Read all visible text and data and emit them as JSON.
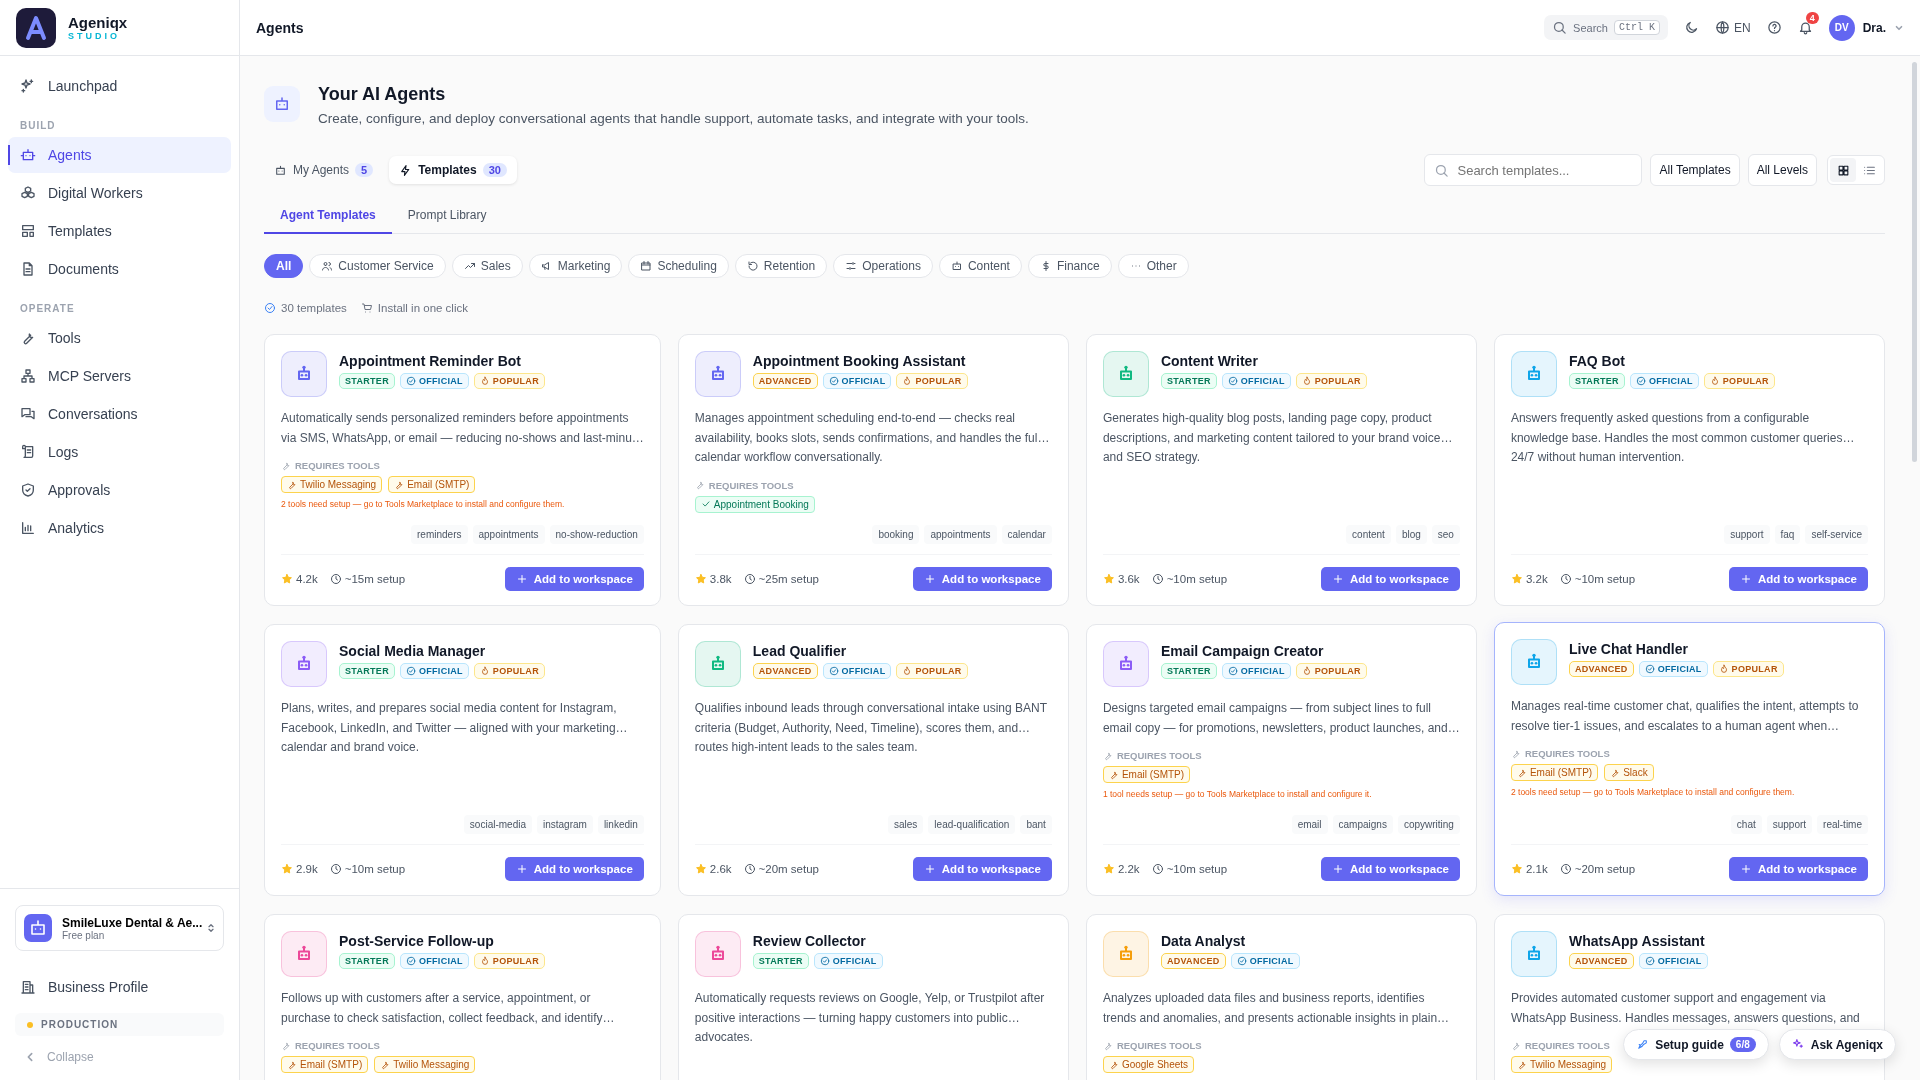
{
  "brand": {
    "name": "Ageniqx",
    "sub": "STUDIO"
  },
  "sidebar": {
    "nav": [
      {
        "kind": "link",
        "label": "Launchpad",
        "selected": false
      },
      {
        "kind": "section",
        "label": "BUILD"
      },
      {
        "kind": "link",
        "label": "Agents",
        "selected": true
      },
      {
        "kind": "link",
        "label": "Digital Workers",
        "selected": false
      },
      {
        "kind": "link",
        "label": "Templates",
        "selected": false
      },
      {
        "kind": "link",
        "label": "Documents",
        "selected": false
      },
      {
        "kind": "section",
        "label": "OPERATE"
      },
      {
        "kind": "link",
        "label": "Tools",
        "selected": false
      },
      {
        "kind": "link",
        "label": "MCP Servers",
        "selected": false
      },
      {
        "kind": "link",
        "label": "Conversations",
        "selected": false
      },
      {
        "kind": "link",
        "label": "Logs",
        "selected": false
      },
      {
        "kind": "link",
        "label": "Approvals",
        "selected": false
      },
      {
        "kind": "link",
        "label": "Analytics",
        "selected": false
      }
    ],
    "workspace": {
      "name": "SmileLuxe Dental & Ae...",
      "plan": "Free plan"
    },
    "business_profile": "Business Profile",
    "environment": "PRODUCTION",
    "collapse": "Collapse"
  },
  "header": {
    "title": "Agents",
    "search": "Search",
    "shortcut": "Ctrl K",
    "language": "EN",
    "notifications": "4",
    "avatar": "DV",
    "user": "Dra."
  },
  "page": {
    "title": "Your AI Agents",
    "subtitle": "Create, configure, and deploy conversational agents that handle support, automate tasks, and integrate with your tools."
  },
  "tabs": [
    {
      "label": "My Agents",
      "count": "5",
      "selected": false
    },
    {
      "label": "Templates",
      "count": "30",
      "selected": true
    }
  ],
  "search": {
    "placeholder": "Search templates..."
  },
  "filters": [
    "All Templates",
    "All Levels"
  ],
  "views": [
    {
      "kind": "grid",
      "selected": true
    },
    {
      "kind": "list",
      "selected": false
    }
  ],
  "subtabs": [
    {
      "label": "Agent Templates",
      "selected": true
    },
    {
      "label": "Prompt Library",
      "selected": false
    }
  ],
  "categories": [
    {
      "label": "All",
      "selected": true
    },
    {
      "label": "Customer Service",
      "selected": false
    },
    {
      "label": "Sales",
      "selected": false
    },
    {
      "label": "Marketing",
      "selected": false
    },
    {
      "label": "Scheduling",
      "selected": false
    },
    {
      "label": "Retention",
      "selected": false
    },
    {
      "label": "Operations",
      "selected": false
    },
    {
      "label": "Content",
      "selected": false
    },
    {
      "label": "Finance",
      "selected": false
    },
    {
      "label": "Other",
      "selected": false
    }
  ],
  "meta": {
    "count": "30 templates",
    "install": "Install in one click"
  },
  "cards": [
    {
      "name": "Appointment Reminder Bot",
      "color": "#6366f1",
      "selected": false,
      "badges": [
        {
          "kind": "starter",
          "label": "STARTER"
        },
        {
          "kind": "official",
          "label": "OFFICIAL"
        },
        {
          "kind": "popular",
          "label": "POPULAR"
        }
      ],
      "description": [
        "Automatically sends personalized reminders before appointments",
        "via SMS, WhatsApp, or email — reducing no-shows and last-minu…"
      ],
      "tools_label": "REQUIRES TOOLS",
      "tools": [
        {
          "name": "Twilio Messaging",
          "installed": false
        },
        {
          "name": "Email (SMTP)",
          "installed": false
        }
      ],
      "tools_note": "2 tools need setup — go to Tools Marketplace to install and configure them.",
      "tags": [
        "reminders",
        "appointments",
        "no-show-reduction"
      ],
      "rating": "4.2k",
      "setup": "~15m setup",
      "action": "Add to workspace"
    },
    {
      "name": "Appointment Booking Assistant",
      "color": "#6366f1",
      "selected": false,
      "badges": [
        {
          "kind": "advanced",
          "label": "ADVANCED"
        },
        {
          "kind": "official",
          "label": "OFFICIAL"
        },
        {
          "kind": "popular",
          "label": "POPULAR"
        }
      ],
      "description": [
        "Manages appointment scheduling end-to-end — checks real",
        "availability, books slots, sends confirmations, and handles the ful…",
        "calendar workflow conversationally."
      ],
      "tools_label": "REQUIRES TOOLS",
      "tools": [
        {
          "name": "Appointment Booking",
          "installed": true
        }
      ],
      "tags": [
        "booking",
        "appointments",
        "calendar"
      ],
      "rating": "3.8k",
      "setup": "~25m setup",
      "action": "Add to workspace"
    },
    {
      "name": "Content Writer",
      "color": "#10b981",
      "selected": false,
      "badges": [
        {
          "kind": "starter",
          "label": "STARTER"
        },
        {
          "kind": "official",
          "label": "OFFICIAL"
        },
        {
          "kind": "popular",
          "label": "POPULAR"
        }
      ],
      "description": [
        "Generates high-quality blog posts, landing page copy, product",
        "descriptions, and marketing content tailored to your brand voice…",
        "and SEO strategy."
      ],
      "tags": [
        "content",
        "blog",
        "seo"
      ],
      "rating": "3.6k",
      "setup": "~10m setup",
      "action": "Add to workspace"
    },
    {
      "name": "FAQ Bot",
      "color": "#0ea5e9",
      "selected": false,
      "badges": [
        {
          "kind": "starter",
          "label": "STARTER"
        },
        {
          "kind": "official",
          "label": "OFFICIAL"
        },
        {
          "kind": "popular",
          "label": "POPULAR"
        }
      ],
      "description": [
        "Answers frequently asked questions from a configurable",
        "knowledge base. Handles the most common customer queries…",
        "24/7 without human intervention."
      ],
      "tags": [
        "support",
        "faq",
        "self-service"
      ],
      "rating": "3.2k",
      "setup": "~10m setup",
      "action": "Add to workspace"
    },
    {
      "name": "Social Media Manager",
      "color": "#8b5cf6",
      "selected": false,
      "badges": [
        {
          "kind": "starter",
          "label": "STARTER"
        },
        {
          "kind": "official",
          "label": "OFFICIAL"
        },
        {
          "kind": "popular",
          "label": "POPULAR"
        }
      ],
      "description": [
        "Plans, writes, and prepares social media content for Instagram,",
        "Facebook, LinkedIn, and Twitter — aligned with your marketing…",
        "calendar and brand voice."
      ],
      "tags": [
        "social-media",
        "instagram",
        "linkedin"
      ],
      "rating": "2.9k",
      "setup": "~10m setup",
      "action": "Add to workspace"
    },
    {
      "name": "Lead Qualifier",
      "color": "#10b981",
      "selected": false,
      "badges": [
        {
          "kind": "advanced",
          "label": "ADVANCED"
        },
        {
          "kind": "official",
          "label": "OFFICIAL"
        },
        {
          "kind": "popular",
          "label": "POPULAR"
        }
      ],
      "description": [
        "Qualifies inbound leads through conversational intake using BANT",
        "criteria (Budget, Authority, Need, Timeline), scores them, and…",
        "routes high-intent leads to the sales team."
      ],
      "tags": [
        "sales",
        "lead-qualification",
        "bant"
      ],
      "rating": "2.6k",
      "setup": "~20m setup",
      "action": "Add to workspace"
    },
    {
      "name": "Email Campaign Creator",
      "color": "#8b5cf6",
      "selected": false,
      "badges": [
        {
          "kind": "starter",
          "label": "STARTER"
        },
        {
          "kind": "official",
          "label": "OFFICIAL"
        },
        {
          "kind": "popular",
          "label": "POPULAR"
        }
      ],
      "description": [
        "Designs targeted email campaigns — from subject lines to full",
        "email copy — for promotions, newsletters, product launches, and…"
      ],
      "tools_label": "REQUIRES TOOLS",
      "tools": [
        {
          "name": "Email (SMTP)",
          "installed": false
        }
      ],
      "tools_note": "1 tool needs setup — go to Tools Marketplace to install and configure it.",
      "tags": [
        "email",
        "campaigns",
        "copywriting"
      ],
      "rating": "2.2k",
      "setup": "~10m setup",
      "action": "Add to workspace"
    },
    {
      "name": "Live Chat Handler",
      "color": "#0ea5e9",
      "selected": true,
      "badges": [
        {
          "kind": "advanced",
          "label": "ADVANCED"
        },
        {
          "kind": "official",
          "label": "OFFICIAL"
        },
        {
          "kind": "popular",
          "label": "POPULAR"
        }
      ],
      "description": [
        "Manages real-time customer chat, qualifies the intent, attempts to",
        "resolve tier-1 issues, and escalates to a human agent when…"
      ],
      "tools_label": "REQUIRES TOOLS",
      "tools": [
        {
          "name": "Email (SMTP)",
          "installed": false
        },
        {
          "name": "Slack",
          "installed": false
        }
      ],
      "tools_note": "2 tools need setup — go to Tools Marketplace to install and configure them.",
      "tags": [
        "chat",
        "support",
        "real-time"
      ],
      "rating": "2.1k",
      "setup": "~20m setup",
      "action": "Add to workspace"
    },
    {
      "name": "Post-Service Follow-up",
      "color": "#ec4899",
      "selected": false,
      "badges": [
        {
          "kind": "starter",
          "label": "STARTER"
        },
        {
          "kind": "official",
          "label": "OFFICIAL"
        },
        {
          "kind": "popular",
          "label": "POPULAR"
        }
      ],
      "description": [
        "Follows up with customers after a service, appointment, or",
        "purchase to check satisfaction, collect feedback, and identify…"
      ],
      "tools_label": "REQUIRES TOOLS",
      "tools": [
        {
          "name": "Email (SMTP)",
          "installed": false
        },
        {
          "name": "Twilio Messaging",
          "installed": false
        }
      ]
    },
    {
      "name": "Review Collector",
      "color": "#ec4899",
      "selected": false,
      "badges": [
        {
          "kind": "starter",
          "label": "STARTER"
        },
        {
          "kind": "official",
          "label": "OFFICIAL"
        }
      ],
      "description": [
        "Automatically requests reviews on Google, Yelp, or Trustpilot after",
        "positive interactions — turning happy customers into public…",
        "advocates."
      ]
    },
    {
      "name": "Data Analyst",
      "color": "#f59e0b",
      "selected": false,
      "badges": [
        {
          "kind": "advanced",
          "label": "ADVANCED"
        },
        {
          "kind": "official",
          "label": "OFFICIAL"
        }
      ],
      "description": [
        "Analyzes uploaded data files and business reports, identifies",
        "trends and anomalies, and presents actionable insights in plain…"
      ],
      "tools_label": "REQUIRES TOOLS",
      "tools": [
        {
          "name": "Google Sheets",
          "installed": false
        }
      ]
    },
    {
      "name": "WhatsApp Assistant",
      "color": "#0ea5e9",
      "selected": false,
      "badges": [
        {
          "kind": "advanced",
          "label": "ADVANCED"
        },
        {
          "kind": "official",
          "label": "OFFICIAL"
        }
      ],
      "description": [
        "Provides automated customer support and engagement via",
        "WhatsApp Business. Handles messages, answers questions, and"
      ],
      "tools_label": "REQUIRES TOOLS",
      "tools": [
        {
          "name": "Twilio Messaging",
          "installed": false
        }
      ]
    }
  ],
  "floating": {
    "setup_guide": "Setup guide",
    "progress": "6/8",
    "assistant": "Ask Ageniqx"
  }
}
